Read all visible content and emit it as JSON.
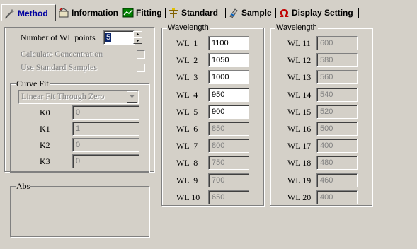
{
  "tabs": [
    {
      "label": "Method",
      "icon": "method-icon",
      "active": true
    },
    {
      "label": "Information",
      "icon": "information-icon"
    },
    {
      "label": "Fitting",
      "icon": "fitting-icon"
    },
    {
      "label": "Standard",
      "icon": "standard-icon"
    },
    {
      "label": "Sample",
      "icon": "sample-icon"
    },
    {
      "label": "Display Setting",
      "icon": "display-setting-icon"
    }
  ],
  "settings": {
    "num_wl_label": "Number of WL points",
    "num_wl_value": "5",
    "calc_conc_label": "Calculate Concentration",
    "use_std_label": "Use Standard Samples"
  },
  "curve_fit": {
    "title": "Curve Fit",
    "method": "Linear Fit Through Zero",
    "coefficients": [
      {
        "label": "K0",
        "value": "0"
      },
      {
        "label": "K1",
        "value": "1"
      },
      {
        "label": "K2",
        "value": "0"
      },
      {
        "label": "K3",
        "value": "0"
      }
    ]
  },
  "abs": {
    "title": "Abs"
  },
  "wavelength_1": {
    "title": "Wavelength",
    "rows": [
      {
        "label": "WL  1",
        "value": "1100"
      },
      {
        "label": "WL  2",
        "value": "1050"
      },
      {
        "label": "WL  3",
        "value": "1000"
      },
      {
        "label": "WL  4",
        "value": "950"
      },
      {
        "label": "WL  5",
        "value": "900"
      },
      {
        "label": "WL  6",
        "value": "850"
      },
      {
        "label": "WL  7",
        "value": "800"
      },
      {
        "label": "WL  8",
        "value": "750"
      },
      {
        "label": "WL  9",
        "value": "700"
      },
      {
        "label": "WL 10",
        "value": "650"
      }
    ]
  },
  "wavelength_2": {
    "title": "Wavelength",
    "rows": [
      {
        "label": "WL 11",
        "value": "600"
      },
      {
        "label": "WL 12",
        "value": "580"
      },
      {
        "label": "WL 13",
        "value": "560"
      },
      {
        "label": "WL 14",
        "value": "540"
      },
      {
        "label": "WL 15",
        "value": "520"
      },
      {
        "label": "WL 16",
        "value": "500"
      },
      {
        "label": "WL 17",
        "value": "400"
      },
      {
        "label": "WL 18",
        "value": "480"
      },
      {
        "label": "WL 19",
        "value": "460"
      },
      {
        "label": "WL 20",
        "value": "400"
      }
    ]
  }
}
